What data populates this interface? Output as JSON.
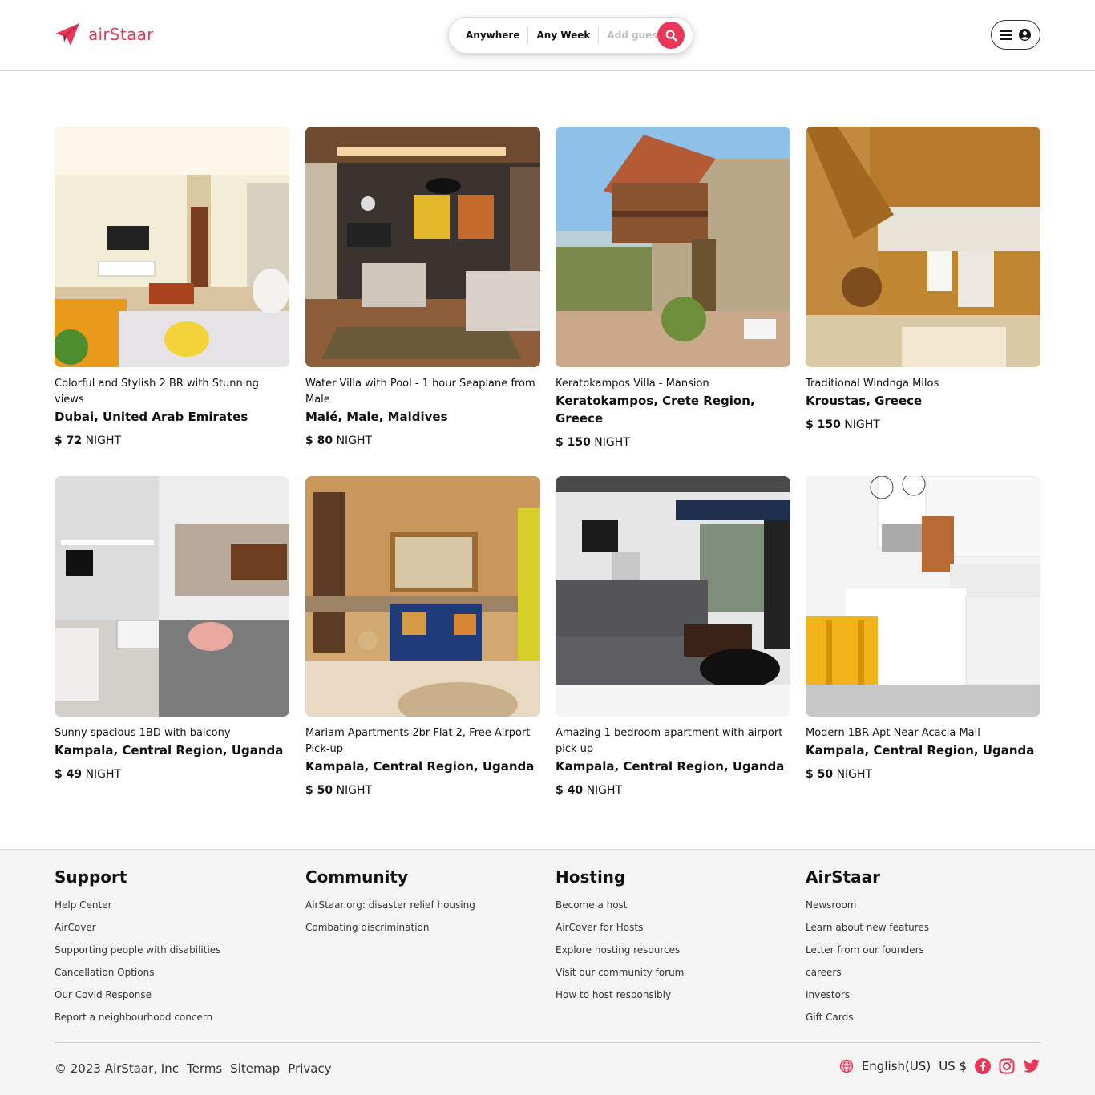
{
  "brand": {
    "name": "airStaar",
    "accent": "#e8385a"
  },
  "search": {
    "where": "Anywhere",
    "when": "Any Week",
    "guests_placeholder": "Add guests"
  },
  "listings": [
    {
      "title": "Colorful and Stylish 2 BR with Stunning views",
      "location": "Dubai, United Arab Emirates",
      "price": "$ 72",
      "unit": "NIGHT"
    },
    {
      "title": "Water Villa with Pool - 1 hour Seaplane from Male",
      "location": "Malé, Male, Maldives",
      "price": "$ 80",
      "unit": "NIGHT"
    },
    {
      "title": "Keratokampos Villa - Mansion",
      "location": "Keratokampos, Crete Region, Greece",
      "price": "$ 150",
      "unit": "NIGHT"
    },
    {
      "title": "Traditional Windnga Milos",
      "location": "Kroustas, Greece",
      "price": "$ 150",
      "unit": "NIGHT"
    },
    {
      "title": "Sunny spacious 1BD with balcony",
      "location": "Kampala, Central Region, Uganda",
      "price": "$ 49",
      "unit": "NIGHT"
    },
    {
      "title": "Mariam Apartments 2br Flat 2, Free Airport Pick-up",
      "location": "Kampala, Central Region, Uganda",
      "price": "$ 50",
      "unit": "NIGHT"
    },
    {
      "title": "Amazing 1 bedroom apartment with airport pick up",
      "location": "Kampala, Central Region, Uganda",
      "price": "$ 40",
      "unit": "NIGHT"
    },
    {
      "title": "Modern 1BR Apt Near Acacia Mall",
      "location": "Kampala, Central Region, Uganda",
      "price": "$ 50",
      "unit": "NIGHT"
    }
  ],
  "footer": {
    "columns": [
      {
        "heading": "Support",
        "links": [
          "Help Center",
          "AirCover",
          "Supporting people with disabilities",
          "Cancellation Options",
          "Our Covid Response",
          "Report a neighbourhood concern"
        ]
      },
      {
        "heading": "Community",
        "links": [
          "AirStaar.org: disaster relief housing",
          "Combating discrimination"
        ]
      },
      {
        "heading": "Hosting",
        "links": [
          "Become a host",
          "AirCover for Hosts",
          "Explore hosting resources",
          "Visit our community forum",
          "How to host responsibly"
        ]
      },
      {
        "heading": "AirStaar",
        "links": [
          "Newsroom",
          "Learn about new features",
          "Letter from our founders",
          "careers",
          "Investors",
          "Gift Cards"
        ]
      }
    ],
    "copyright": "© 2023 AirStaar, Inc",
    "legal_links": [
      "Terms",
      "Sitemap",
      "Privacy"
    ],
    "language": "English(US)",
    "currency": "US $"
  }
}
